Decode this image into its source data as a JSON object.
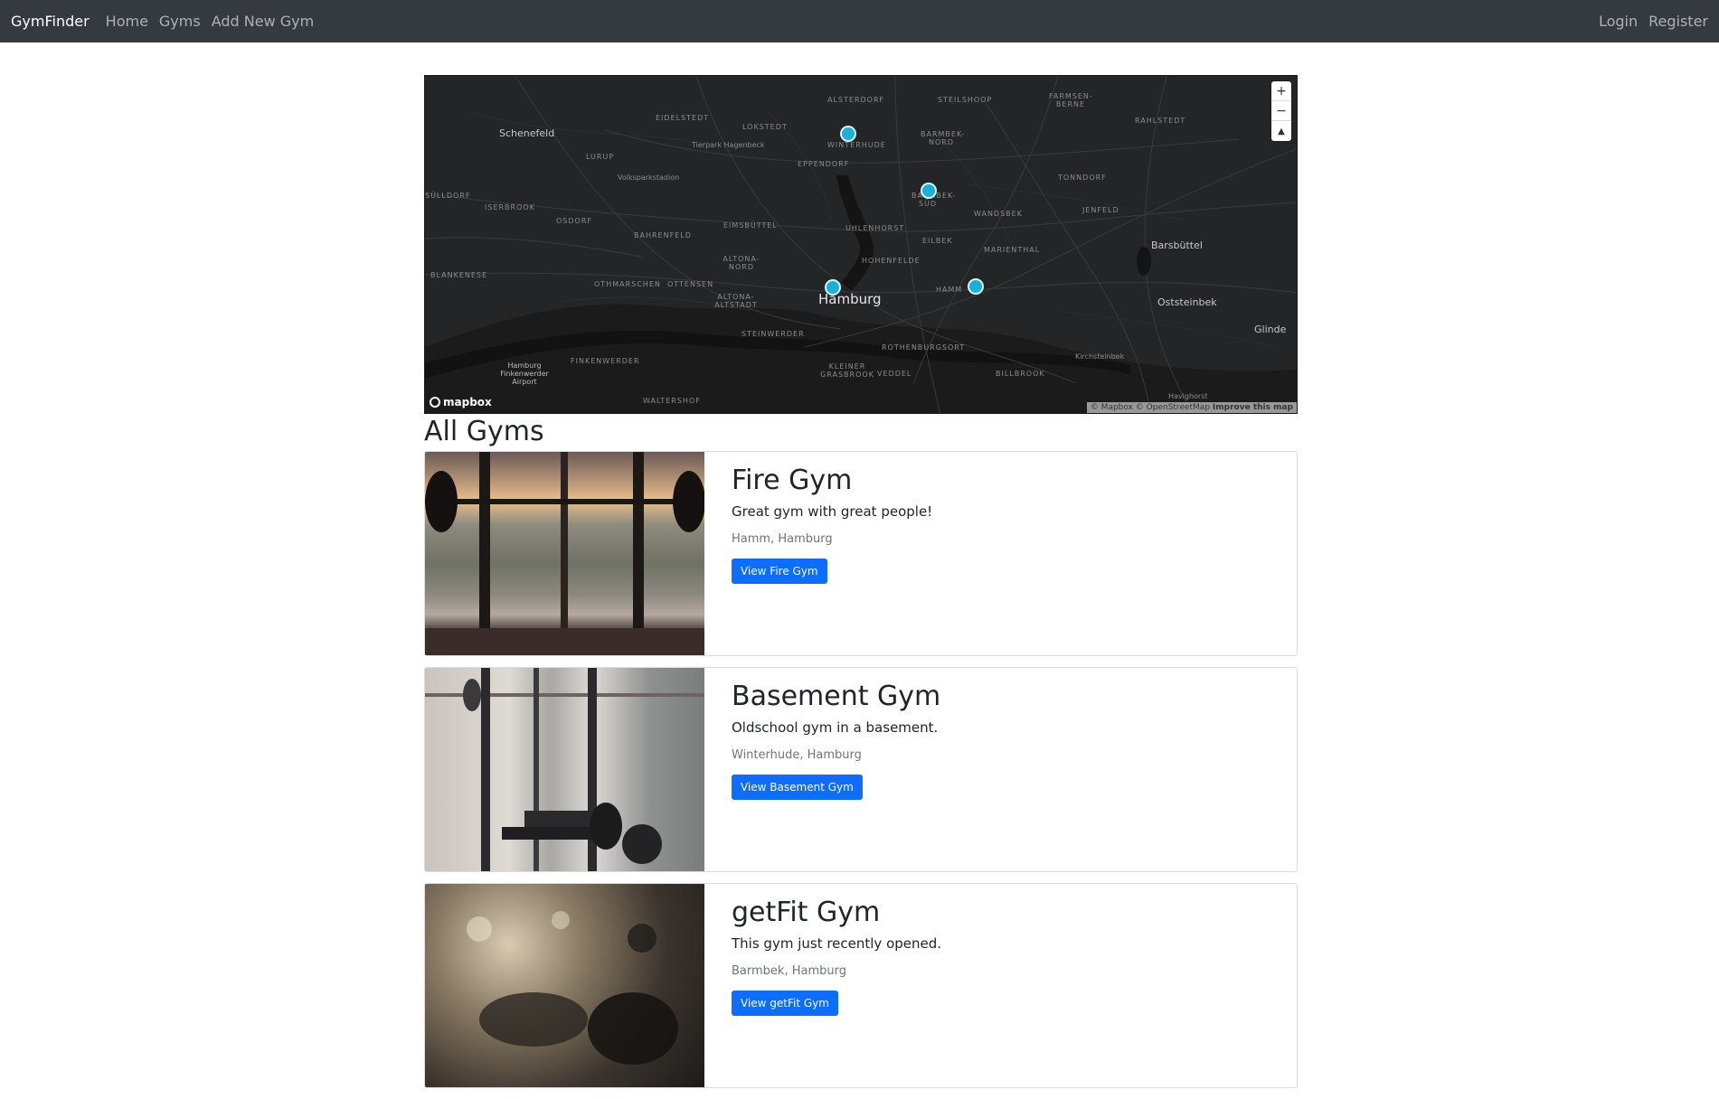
{
  "navbar": {
    "brand": "GymFinder",
    "links": [
      "Home",
      "Gyms",
      "Add New Gym"
    ],
    "right_links": [
      "Login",
      "Register"
    ]
  },
  "map": {
    "labels": {
      "schenefeld": "Schenefeld",
      "eidelstedt": "EIDELSTEDT",
      "lokstedt": "LOKSTEDT",
      "alsterdorf": "ALSTERDORF",
      "steilshoop": "STEILSHOOP",
      "farmsen": "FARMSEN-BERNE",
      "rahlstedt": "RAHLSTEDT",
      "tierpark": "Tierpark Hagenbeck",
      "lurup": "LURUP",
      "winterhude": "WINTERHUDE",
      "barmbek_nord": "BARMBEK-NORD",
      "eppendorf": "EPPENDORF",
      "volkspark": "Volksparkstadion",
      "sulldorf": "SÜLLDORF",
      "iserbrook": "ISERBROOK",
      "osdorf": "OSDORF",
      "eimsbuttel": "EIMSBÜTTEL",
      "barmbek_sud": "BARMBEK-SÜD",
      "tonndorf": "TONNDORF",
      "jenfeld": "JENFELD",
      "wandsbek": "WANDSBEK",
      "uhlenhorst": "UHLENHORST",
      "bahrenfeld": "BAHRENFELD",
      "eilbek": "EILBEK",
      "barsbuttel": "Barsbüttel",
      "marienthal": "MARIENTHAL",
      "blankenese": "BLANKENESE",
      "altona_nord": "ALTONA-NORD",
      "hohenfelde": "HOHENFELDE",
      "othmarschen": "OTHMARSCHEN",
      "ottensen": "OTTENSEN",
      "hamburg": "Hamburg",
      "hamm": "HAMM",
      "altona_altstadt": "ALTONA-ALTSTADT",
      "oststeinbek": "Oststeinbek",
      "glinde": "Glinde",
      "steinwerder": "STEINWERDER",
      "finkenwerder": "FINKENWERDER",
      "rothenburgsort": "ROTHENBURGSORT",
      "kirchsteinbek": "Kirchsteinbek",
      "airport": "Hamburg Finkenwerder Airport",
      "kleiner_grasbrook": "KLEINER GRASBROOK",
      "veddel": "VEDDEL",
      "billbrook": "BILLBROOK",
      "waltershof": "WALTERSHOF",
      "havighorst": "Havighorst"
    },
    "zoom_in": "+",
    "zoom_out": "−",
    "compass": "▲",
    "logo": "mapbox",
    "attribution": "© Mapbox © OpenStreetMap",
    "improve": "Improve this map",
    "marker_color": "#1bb1d6"
  },
  "heading": "All Gyms",
  "gyms": [
    {
      "title": "Fire Gym",
      "description": "Great gym with great people!",
      "location": "Hamm, Hamburg",
      "button": "View Fire Gym"
    },
    {
      "title": "Basement Gym",
      "description": "Oldschool gym in a basement.",
      "location": "Winterhude, Hamburg",
      "button": "View Basement Gym"
    },
    {
      "title": "getFit Gym",
      "description": "This gym just recently opened.",
      "location": "Barmbek, Hamburg",
      "button": "View getFit Gym"
    }
  ],
  "colors": {
    "navbar_bg": "#343a40",
    "button_bg": "#0d6efd"
  }
}
